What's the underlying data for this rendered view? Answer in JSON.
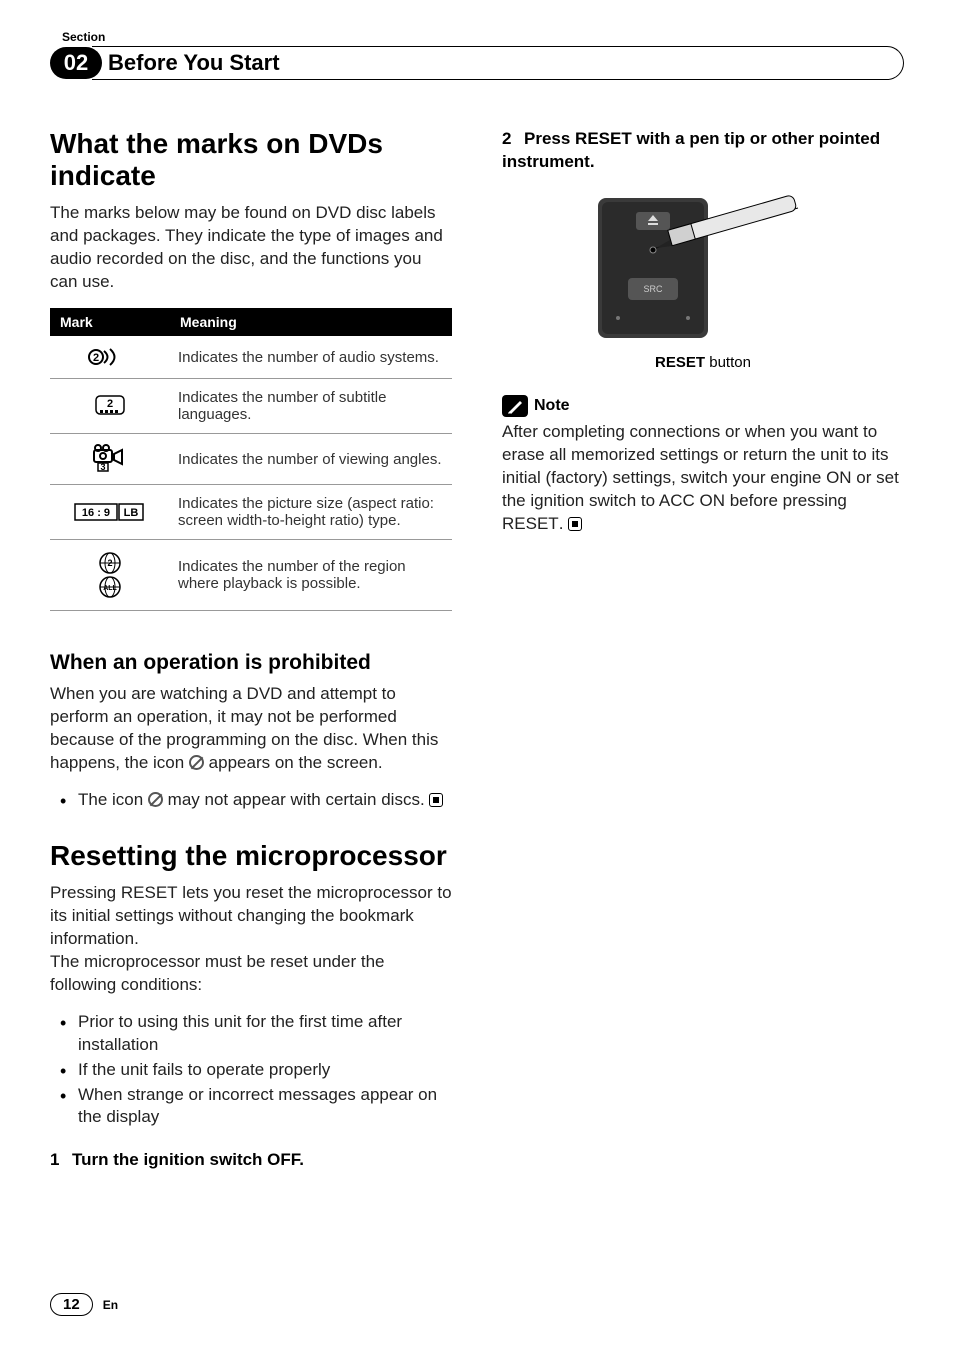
{
  "section_label": "Section",
  "chapter_number": "02",
  "chapter_title": "Before You Start",
  "h1_1": "What the marks on DVDs indicate",
  "intro_1": "The marks below may be found on DVD disc labels and packages. They indicate the type of images and audio recorded on the disc, and the functions you can use.",
  "table": {
    "head_mark": "Mark",
    "head_meaning": "Meaning",
    "rows": [
      {
        "icon": "audio-systems-icon",
        "meaning": "Indicates the number of audio systems."
      },
      {
        "icon": "subtitle-languages-icon",
        "meaning": "Indicates the number of subtitle languages."
      },
      {
        "icon": "viewing-angles-icon",
        "meaning": "Indicates the number of viewing angles."
      },
      {
        "icon": "aspect-ratio-icon",
        "meaning": "Indicates the picture size (aspect ratio: screen width-to-height ratio) type."
      },
      {
        "icon": "region-code-icon",
        "meaning": "Indicates the number of the region where playback is possible."
      }
    ]
  },
  "h2_prohibited": "When an operation is prohibited",
  "prohibited_p1a": "When you are watching a DVD and attempt to perform an operation, it may not be performed because of the programming on the disc. When this happens, the icon ",
  "prohibited_p1b": " appears on the screen.",
  "prohibited_bullet_a": "The icon ",
  "prohibited_bullet_b": " may not appear with certain discs.",
  "h1_reset": "Resetting the microprocessor",
  "reset_p1": "Pressing RESET lets you reset the microprocessor to its initial settings without changing the bookmark information.",
  "reset_p1_prefix": "Pressing ",
  "reset_p1_bold": "RESET",
  "reset_p1_suffix": " lets you reset the microprocessor to its initial settings without changing the bookmark information.",
  "reset_p2": "The microprocessor must be reset under the following conditions:",
  "reset_bullets": [
    "Prior to using this unit for the first time after installation",
    "If the unit fails to operate properly",
    "When strange or incorrect messages appear on the display"
  ],
  "step1_num": "1",
  "step1_text": "Turn the ignition switch OFF.",
  "step2_num": "2",
  "step2_text": "Press RESET with a pen tip or other pointed instrument.",
  "reset_caption_bold": "RESET",
  "reset_caption_rest": " button",
  "note_label": "Note",
  "note_body_a": "After completing connections or when you want to erase all memorized settings or return the unit to its initial (factory) settings, switch your engine ON or set the ignition switch to ACC ON before pressing ",
  "note_body_bold": "RESET",
  "note_body_b": ".",
  "page_number": "12",
  "lang": "En",
  "aspect_label": "16 : 9",
  "aspect_lb": "LB",
  "src_label": "SRC"
}
